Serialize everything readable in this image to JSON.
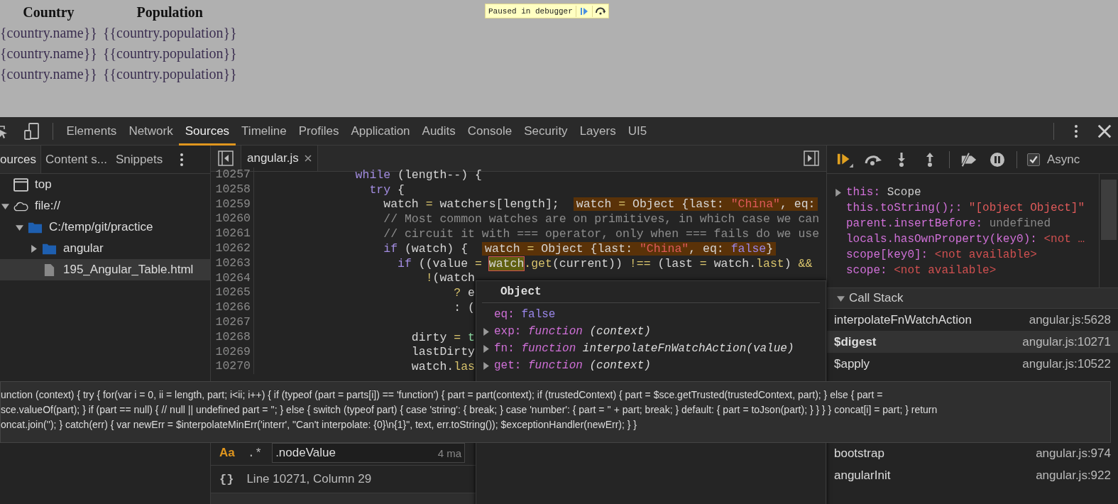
{
  "page": {
    "headers": [
      "Country",
      "Population"
    ],
    "rows": [
      [
        "{country.name}}",
        "{{country.population}}"
      ],
      [
        "{country.name}}",
        "{{country.population}}"
      ],
      [
        "{country.name}}",
        "{{country.population}}"
      ]
    ],
    "paused_banner": "Paused in debugger"
  },
  "devtools": {
    "tabs": [
      {
        "label": "Elements",
        "selected": false
      },
      {
        "label": "Network",
        "selected": false
      },
      {
        "label": "Sources",
        "selected": true
      },
      {
        "label": "Timeline",
        "selected": false
      },
      {
        "label": "Profiles",
        "selected": false
      },
      {
        "label": "Application",
        "selected": false
      },
      {
        "label": "Audits",
        "selected": false
      },
      {
        "label": "Console",
        "selected": false
      },
      {
        "label": "Security",
        "selected": false
      },
      {
        "label": "Layers",
        "selected": false
      },
      {
        "label": "UI5",
        "selected": false
      }
    ],
    "navigator": {
      "tabs": [
        {
          "label": "ources",
          "selected": true
        },
        {
          "label": "Content s...",
          "selected": false
        },
        {
          "label": "Snippets",
          "selected": false
        }
      ],
      "tree": [
        {
          "label": "top",
          "kind": "frame",
          "selected": false
        },
        {
          "label": "file://",
          "kind": "cloud",
          "expanded": true,
          "selected": false,
          "children": [
            {
              "label": "C:/temp/git/practice",
              "kind": "folder",
              "expanded": true,
              "selected": false,
              "children": [
                {
                  "label": "angular",
                  "kind": "folder",
                  "expanded": false,
                  "selected": false
                },
                {
                  "label": "195_Angular_Table.html",
                  "kind": "file",
                  "selected": true
                }
              ]
            }
          ]
        }
      ]
    },
    "editor": {
      "tab": "angular.js",
      "lines": [
        {
          "number": "10257",
          "tokens": [
            {
              "kind": "keyword",
              "text": "              while"
            },
            {
              "kind": "plain",
              "text": " (length--) {"
            }
          ]
        },
        {
          "number": "10258",
          "tokens": [
            {
              "kind": "keyword",
              "text": "                try"
            },
            {
              "kind": "plain",
              "text": " {"
            }
          ]
        },
        {
          "number": "10259",
          "tokens": [
            {
              "kind": "plain",
              "text": "                  watch "
            },
            {
              "kind": "op",
              "text": "="
            },
            {
              "kind": "plain",
              "text": " watchers[length];"
            }
          ],
          "inline": [
            {
              "kind": "plain",
              "text": "watch "
            },
            {
              "kind": "op",
              "text": "="
            },
            {
              "kind": "plain",
              "text": " Object {last: "
            },
            {
              "kind": "string",
              "text": "\"China\""
            },
            {
              "kind": "plain",
              "text": ", eq:"
            }
          ]
        },
        {
          "number": "10260",
          "tokens": [
            {
              "kind": "comment",
              "text": "                  // Most common watches are on primitives, in which case we can"
            }
          ]
        },
        {
          "number": "10261",
          "tokens": [
            {
              "kind": "comment",
              "text": "                  // circuit it with === operator, only when === fails do we use"
            }
          ]
        },
        {
          "number": "10262",
          "tokens": [
            {
              "kind": "keyword",
              "text": "                  if"
            },
            {
              "kind": "plain",
              "text": " (watch) {"
            }
          ],
          "inline": [
            {
              "kind": "plain",
              "text": "watch "
            },
            {
              "kind": "op",
              "text": "="
            },
            {
              "kind": "plain",
              "text": " Object {last: "
            },
            {
              "kind": "string",
              "text": "\"China\""
            },
            {
              "kind": "plain",
              "text": ", eq: "
            },
            {
              "kind": "boolean",
              "text": "false"
            },
            {
              "kind": "plain",
              "text": "}"
            }
          ]
        },
        {
          "number": "10263",
          "tokens": [
            {
              "kind": "keyword",
              "text": "                    if"
            },
            {
              "kind": "plain",
              "text": " ((value "
            },
            {
              "kind": "op",
              "text": "= "
            },
            {
              "kind": "match",
              "text": "watch"
            },
            {
              "kind": "prop",
              "text": ".get"
            },
            {
              "kind": "plain",
              "text": "(current)) "
            },
            {
              "kind": "op",
              "text": "!=="
            },
            {
              "kind": "plain",
              "text": " (last "
            },
            {
              "kind": "op",
              "text": "="
            },
            {
              "kind": "plain",
              "text": " watch."
            },
            {
              "kind": "prop",
              "text": "last"
            },
            {
              "kind": "plain",
              "text": ") "
            },
            {
              "kind": "op",
              "text": "&&"
            }
          ]
        },
        {
          "number": "10264",
          "tokens": [
            {
              "kind": "op",
              "text": "                        !"
            },
            {
              "kind": "plain",
              "text": "(watch"
            }
          ]
        },
        {
          "number": "10265",
          "tokens": [
            {
              "kind": "op",
              "text": "                            ?"
            },
            {
              "kind": "plain",
              "text": " e"
            }
          ]
        },
        {
          "number": "10266",
          "tokens": [
            {
              "kind": "plain",
              "text": "                            : ("
            }
          ]
        },
        {
          "number": "10267"
        },
        {
          "number": "10268",
          "tokens": [
            {
              "kind": "plain",
              "text": "                      dirty "
            },
            {
              "kind": "op",
              "text": "= "
            },
            {
              "kind": "constant",
              "text": "t"
            }
          ]
        },
        {
          "number": "10269",
          "tokens": [
            {
              "kind": "plain",
              "text": "                      lastDirty"
            }
          ]
        },
        {
          "number": "10270",
          "tokens": [
            {
              "kind": "plain",
              "text": "                      watch."
            },
            {
              "kind": "prop",
              "text": "las"
            }
          ]
        }
      ],
      "search": {
        "value": ".nodeValue",
        "matches": "4 ma",
        "case_sensitive_label": "Aa",
        "regex_label": ".*"
      },
      "status": {
        "format_label": "{}",
        "position": "Line 10271, Column 29"
      }
    },
    "popover": {
      "title": "Object",
      "rows": [
        {
          "key": "eq:",
          "value": "false",
          "kind": "boolean",
          "expandable": false
        },
        {
          "key": "exp:",
          "prefix": "function",
          "value": "(context)",
          "kind": "function",
          "expandable": true
        },
        {
          "key": "fn:",
          "prefix": "function",
          "value": "interpolateFnWatchAction(value)",
          "kind": "function",
          "expandable": true
        },
        {
          "key": "get:",
          "prefix": "function",
          "value": "(context)",
          "kind": "function",
          "expandable": true
        }
      ]
    },
    "tooltip": [
      "unction (context) { try { for(var i = 0, ii = length, part; i<ii; i++) { if (typeof (part = parts[i]) == 'function') { part = part(context); if (trustedContext) { part = $sce.getTrusted(trustedContext, part); } else { part =",
      "sce.valueOf(part); } if (part == null) { // null || undefined part = ''; } else { switch (typeof part) { case 'string': { break; } case 'number': { part = '' + part; break; } default: { part = toJson(part); } } } } concat[i] = part; } return",
      "oncat.join(''); } catch(err) { var newErr = $interpolateMinErr('interr', \"Can't interpolate: {0}\\n{1}\", text, err.toString()); $exceptionHandler(newErr); } }"
    ],
    "sidebar": {
      "async": {
        "label": "Async",
        "checked": true
      },
      "scope": [
        {
          "key": "this:",
          "value": "Scope",
          "kind": "object",
          "expandable": true
        },
        {
          "key": "this.toString();:",
          "value": "\"[object Object]\"",
          "kind": "string",
          "expandable": false
        },
        {
          "key": "parent.insertBefore:",
          "value": "undefined",
          "kind": "undefined",
          "expandable": false
        },
        {
          "key": "locals.hasOwnProperty(key0):",
          "value": "<not …",
          "kind": "unavailable",
          "expandable": false
        },
        {
          "key": "scope[key0]:",
          "value": "<not available>",
          "kind": "unavailable",
          "expandable": false
        },
        {
          "key": "scope:",
          "value": "<not available>",
          "kind": "unavailable",
          "expandable": false
        }
      ],
      "call_stack": {
        "title": "Call Stack",
        "expanded": true,
        "frames": [
          {
            "name": "interpolateFnWatchAction",
            "location": "angular.js:5628",
            "selected": false
          },
          {
            "name": "$digest",
            "location": "angular.js:10271",
            "selected": true
          },
          {
            "name": "$apply",
            "location": "angular.js:10522",
            "selected": false
          },
          {
            "name": "bootstrap",
            "location": "angular.js:974",
            "selected": false
          },
          {
            "name": "angularInit",
            "location": "angular.js:922",
            "selected": false
          }
        ]
      }
    }
  }
}
